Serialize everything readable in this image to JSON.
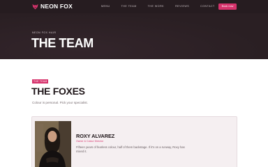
{
  "brand": {
    "name": "NEON FOX",
    "accent": "#d6336c"
  },
  "nav": {
    "links": [
      "MENU",
      "THE TEAM",
      "THE WORK",
      "REVIEWS",
      "CONTACT"
    ],
    "cta_label": "Book now"
  },
  "hero": {
    "eyebrow": "NEON FOX HAIR",
    "title": "THE TEAM"
  },
  "section": {
    "badge": "THE TEAM",
    "title": "THE FOXES",
    "subtitle": "Colour is personal. Pick your specialist."
  },
  "team": [
    {
      "name": "ROXY ALVAREZ",
      "role": "Owner & Colour Director",
      "bio": "Fifteen years of fearless colour, half of them backstage. If it's on a runway, Roxy has mixed it."
    }
  ]
}
